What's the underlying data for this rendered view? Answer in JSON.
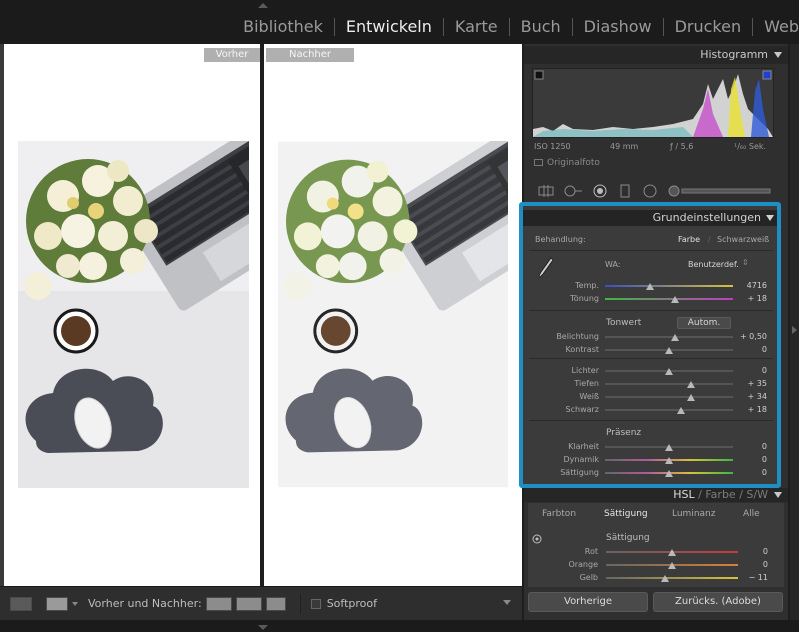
{
  "modules": [
    "Bibliothek",
    "Entwickeln",
    "Karte",
    "Buch",
    "Diashow",
    "Drucken",
    "Web"
  ],
  "active_module": "Entwickeln",
  "compare": {
    "before_label": "Vorher",
    "after_label": "Nachher"
  },
  "histogram": {
    "title": "Histogramm",
    "iso": "ISO 1250",
    "focal": "49 mm",
    "aperture": "ƒ / 5,6",
    "shutter": "¹/₆₀ Sek.",
    "original_photo": "Originalfoto"
  },
  "basic": {
    "title": "Grundeinstellungen",
    "treatment_label": "Behandlung:",
    "treatment_color": "Farbe",
    "treatment_bw": "Schwarzweiß",
    "wb_label": "WA:",
    "wb_value": "Benutzerdef.",
    "temp": {
      "label": "Temp.",
      "value": "4716",
      "level": 0.35
    },
    "tint": {
      "label": "Tönung",
      "value": "+ 18",
      "level": 0.55
    },
    "tone_title": "Tonwert",
    "auto_label": "Autom.",
    "exposure": {
      "label": "Belichtung",
      "value": "+ 0,50",
      "level": 0.55
    },
    "contrast": {
      "label": "Kontrast",
      "value": "0",
      "level": 0.5
    },
    "highlights": {
      "label": "Lichter",
      "value": "0",
      "level": 0.5
    },
    "shadows": {
      "label": "Tiefen",
      "value": "+ 35",
      "level": 0.67
    },
    "whites": {
      "label": "Weiß",
      "value": "+ 34",
      "level": 0.67
    },
    "blacks": {
      "label": "Schwarz",
      "value": "+ 18",
      "level": 0.59
    },
    "presence_title": "Präsenz",
    "clarity": {
      "label": "Klarheit",
      "value": "0",
      "level": 0.5
    },
    "vibrance": {
      "label": "Dynamik",
      "value": "0",
      "level": 0.5
    },
    "saturation": {
      "label": "Sättigung",
      "value": "0",
      "level": 0.5
    }
  },
  "hsl": {
    "tab_hsl": "HSL",
    "sep1": "/",
    "tab_color": "Farbe",
    "sep2": "/",
    "tab_sw": "S/W",
    "tabs": [
      "Farbton",
      "Sättigung",
      "Luminanz",
      "Alle"
    ],
    "active_tab": "Sättigung",
    "section_title": "Sättigung",
    "red": {
      "label": "Rot",
      "value": "0",
      "level": 0.5
    },
    "orange": {
      "label": "Orange",
      "value": "0",
      "level": 0.5
    },
    "yellow": {
      "label": "Gelb",
      "value": "− 11",
      "level": 0.45
    }
  },
  "footer": {
    "before_after_label": "Vorher und Nachher:",
    "softproof_label": "Softproof",
    "previous_button": "Vorherige",
    "reset_button": "Zurücks. (Adobe)"
  },
  "colors": {
    "highlight_border": "#1e8fc2",
    "panel_bg": "#3b3b3b"
  }
}
